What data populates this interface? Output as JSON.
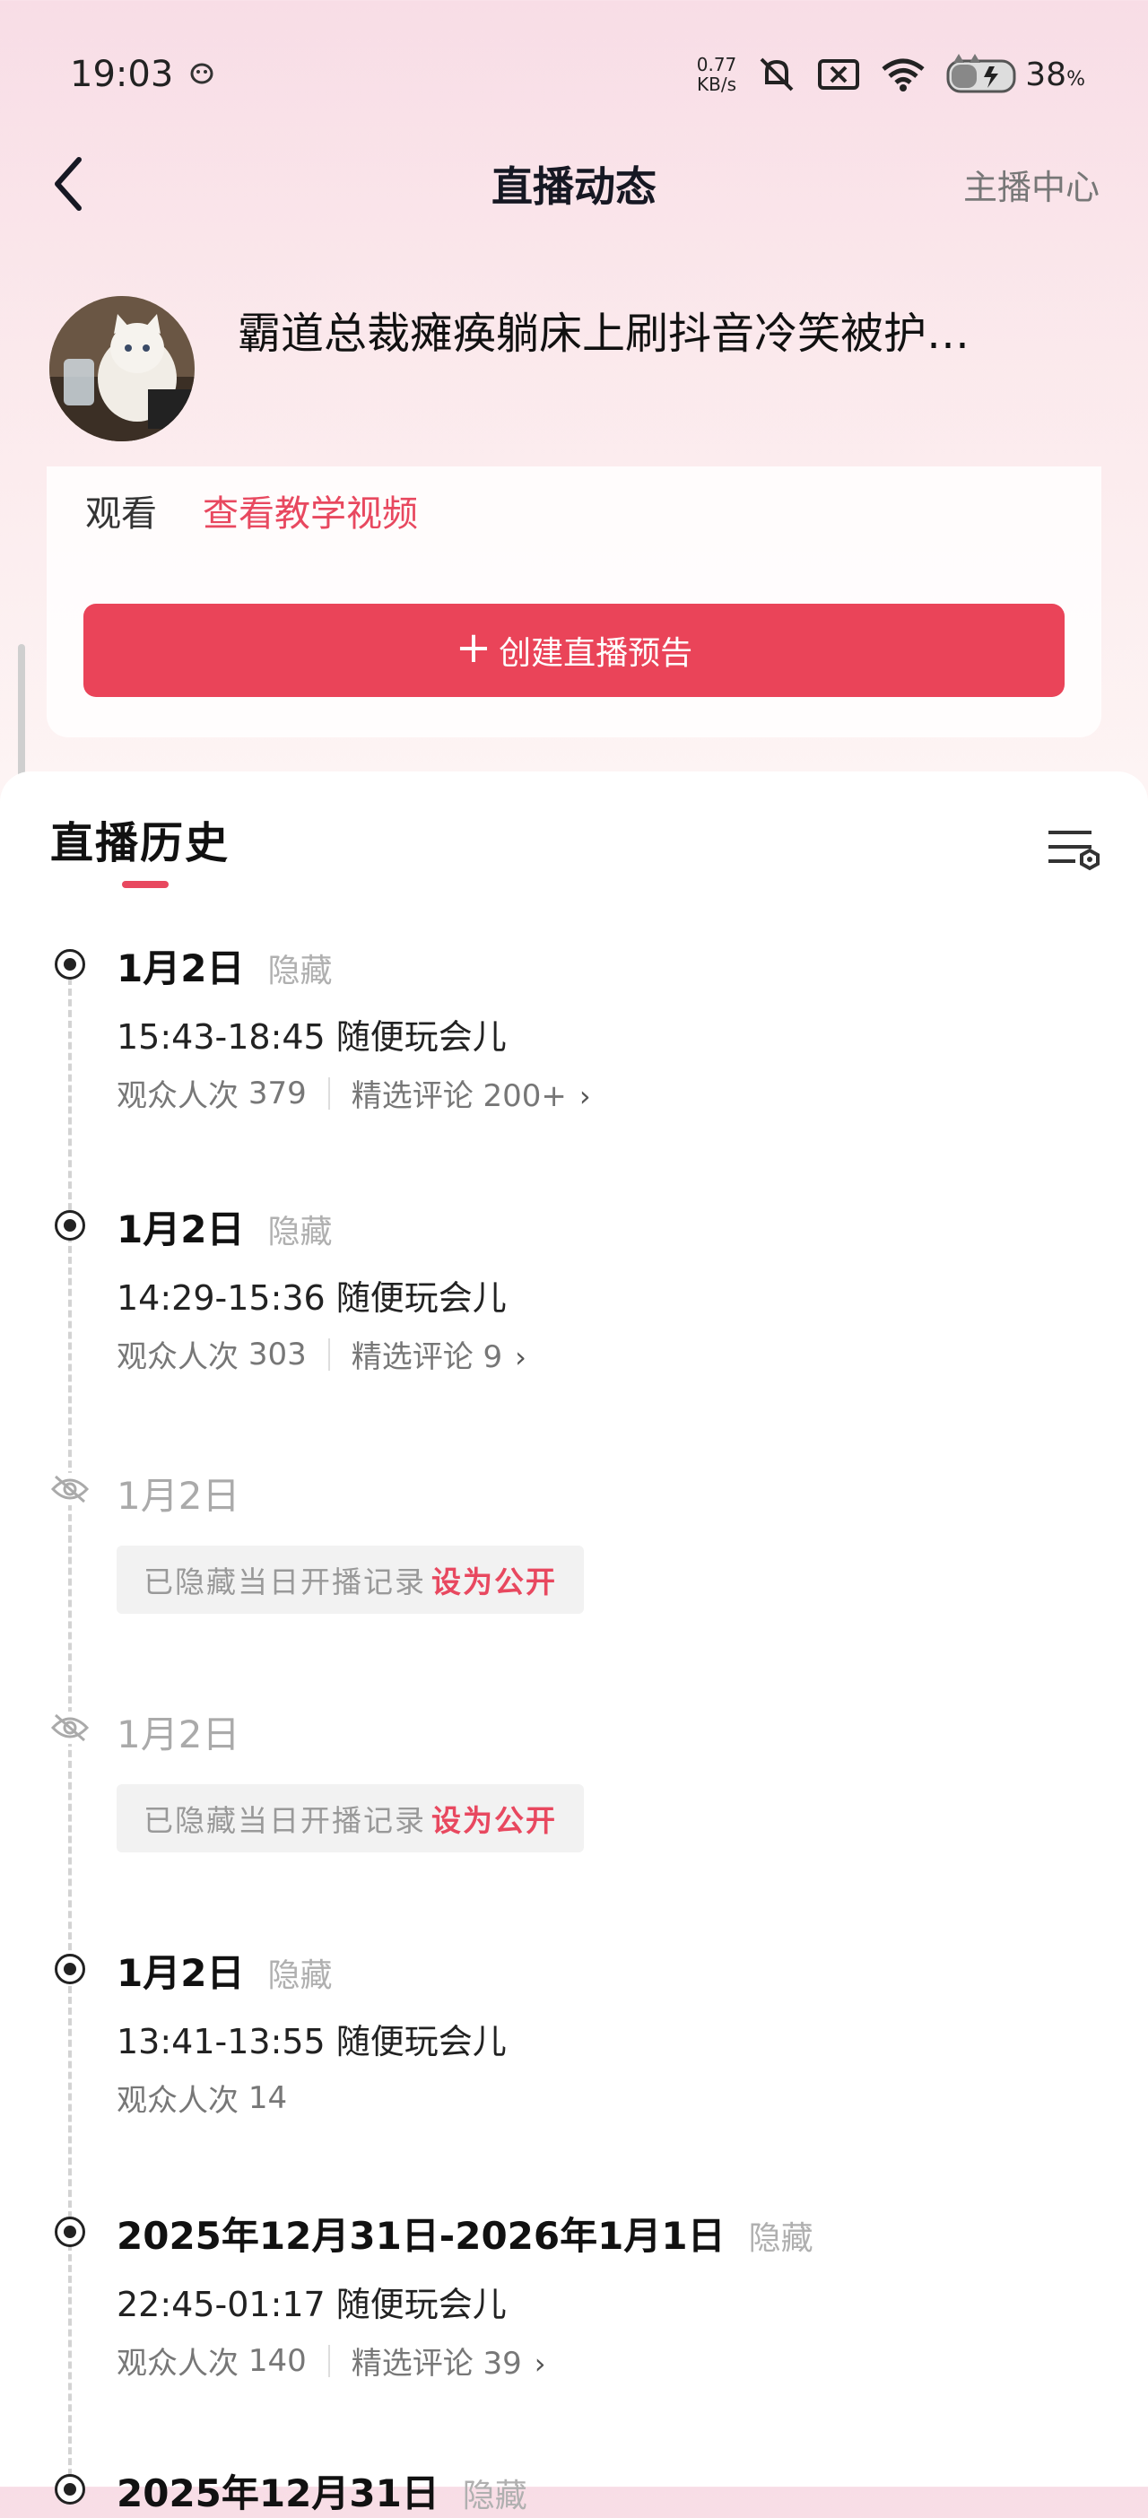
{
  "status_bar": {
    "time": "19:03",
    "speed_value": "0.77",
    "speed_unit": "KB/s",
    "battery": "38",
    "battery_unit": "%"
  },
  "header": {
    "title": "直播动态",
    "right_link": "主播中心"
  },
  "profile": {
    "headline": "霸道总裁瘫痪躺床上刷抖音冷笑被护…"
  },
  "card": {
    "watch_text": "观看",
    "tutorial_link": "查看教学视频",
    "create_button_plus": "+",
    "create_button": "创建直播预告"
  },
  "history": {
    "title": "直播历史",
    "entries": [
      {
        "date": "1月2日",
        "tag": "隐藏",
        "time_title": "15:43-18:45 随便玩会儿",
        "viewers_label": "观众人次",
        "viewers": "379",
        "comments_label": "精选评论",
        "comments": "200+"
      },
      {
        "date": "1月2日",
        "tag": "隐藏",
        "time_title": "14:29-15:36 随便玩会儿",
        "viewers_label": "观众人次",
        "viewers": "303",
        "comments_label": "精选评论",
        "comments": "9"
      },
      {
        "date": "1月2日",
        "hidden_text": "已隐藏当日开播记录",
        "action": "设为公开"
      },
      {
        "date": "1月2日",
        "hidden_text": "已隐藏当日开播记录",
        "action": "设为公开"
      },
      {
        "date": "1月2日",
        "tag": "隐藏",
        "time_title": "13:41-13:55 随便玩会儿",
        "viewers_label": "观众人次",
        "viewers": "14"
      },
      {
        "date": "2025年12月31日-2026年1月1日",
        "tag": "隐藏",
        "time_title": "22:45-01:17 随便玩会儿",
        "viewers_label": "观众人次",
        "viewers": "140",
        "comments_label": "精选评论",
        "comments": "39"
      },
      {
        "date": "2025年12月31日",
        "tag": "隐藏"
      }
    ]
  },
  "colors": {
    "accent": "#ea4459",
    "link": "#e8485f"
  }
}
